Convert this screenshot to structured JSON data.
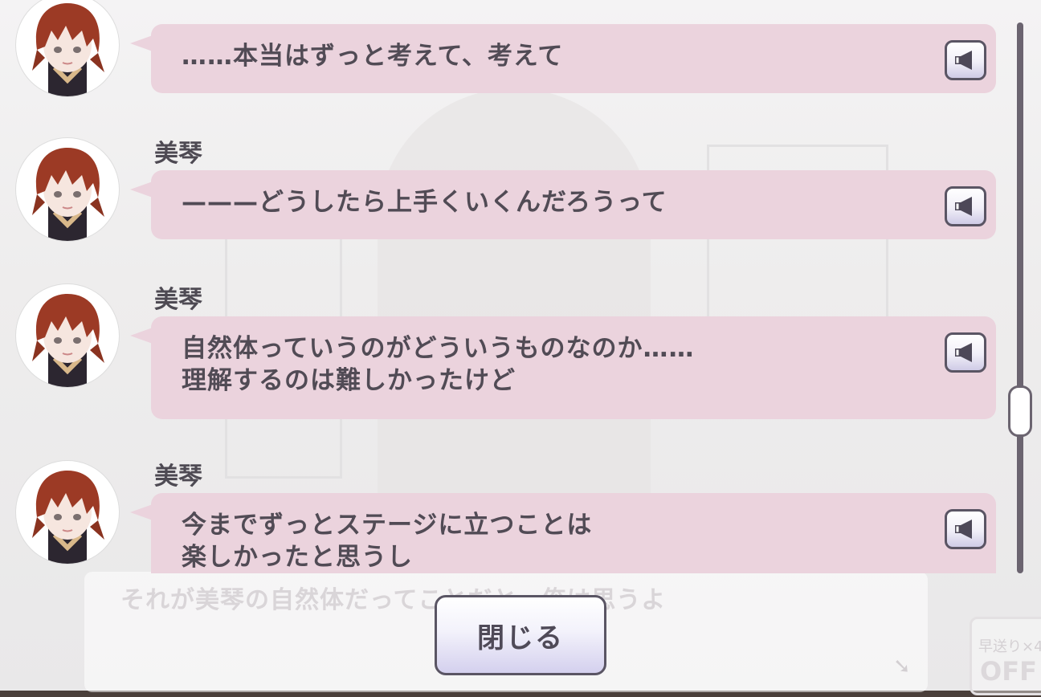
{
  "background": {
    "dialogue_text": "それが美琴の自然体だってことだと、俺は思うよ",
    "fast_forward_label": "早送り×4",
    "fast_forward_state": "OFF"
  },
  "log": {
    "entries": [
      {
        "speaker": "",
        "text": "……本当はずっと考えて、考えて"
      },
      {
        "speaker": "美琴",
        "text": "———どうしたら上手くいくんだろうって"
      },
      {
        "speaker": "美琴",
        "text": "自然体っていうのがどういうものなのか……\n理解するのは難しかったけど"
      },
      {
        "speaker": "美琴",
        "text": "今までずっとステージに立つことは\n楽しかったと思うし"
      }
    ]
  },
  "scrollbar": {
    "position_fraction": 0.7
  },
  "close_button": {
    "label": "閉じる"
  },
  "colors": {
    "bubble": "#ebd3dd",
    "text": "#514b55",
    "accent": "#5a5564"
  }
}
